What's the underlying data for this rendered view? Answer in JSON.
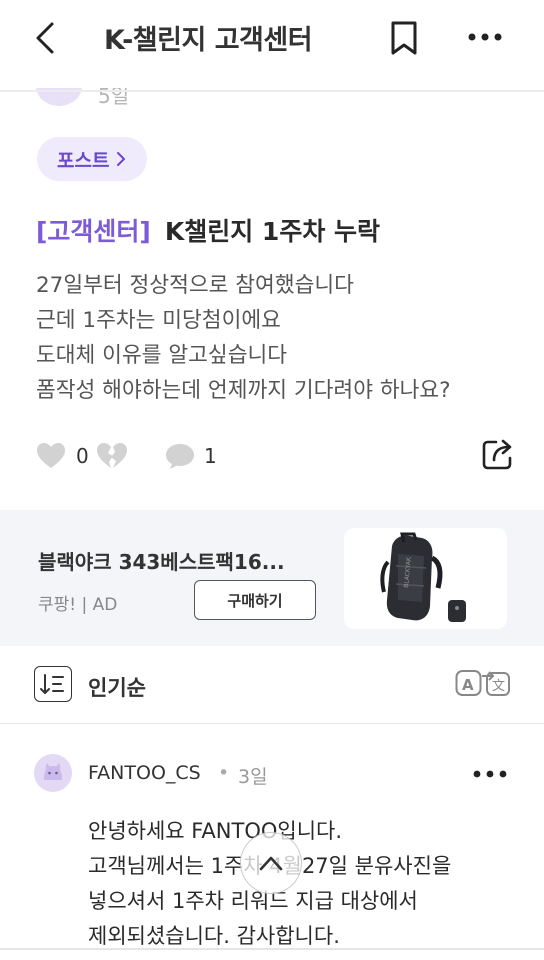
{
  "header": {
    "title": "K-챌린지 고객센터"
  },
  "post": {
    "author_date_partial": "5일",
    "chip_label": "포스트",
    "tag": "[고객센터]",
    "title": "K챌린지 1주차 누락",
    "body_lines": [
      "27일부터 정상적으로 참여했습니다",
      "근데 1주차는 미당첨이에요",
      "도대체 이유를 알고싶습니다",
      "폼작성 해야하는데 언제까지 기다려야 하나요?"
    ],
    "likes": "0",
    "comments": "1"
  },
  "ad": {
    "title": "블랙야크 343베스트팩16...",
    "source": "쿠팡! | AD",
    "button_label": "구매하기",
    "image_brand": "BLACKYAK"
  },
  "sort": {
    "label": "인기순"
  },
  "comment": {
    "author": "FANTOO_CS",
    "separator": "•",
    "date": "3일",
    "body_lines": [
      "안녕하세요 FANTOO입니다.",
      "고객님께서는 1주차 4월27일 분유사진을",
      "넣으셔서 1주차 리워드 지급 대상에서",
      "제외되셨습니다. 감사합니다."
    ]
  },
  "colors": {
    "accent": "#7d5ad8",
    "chip_bg": "#efeafc",
    "ad_bg": "#f3f5f9"
  }
}
